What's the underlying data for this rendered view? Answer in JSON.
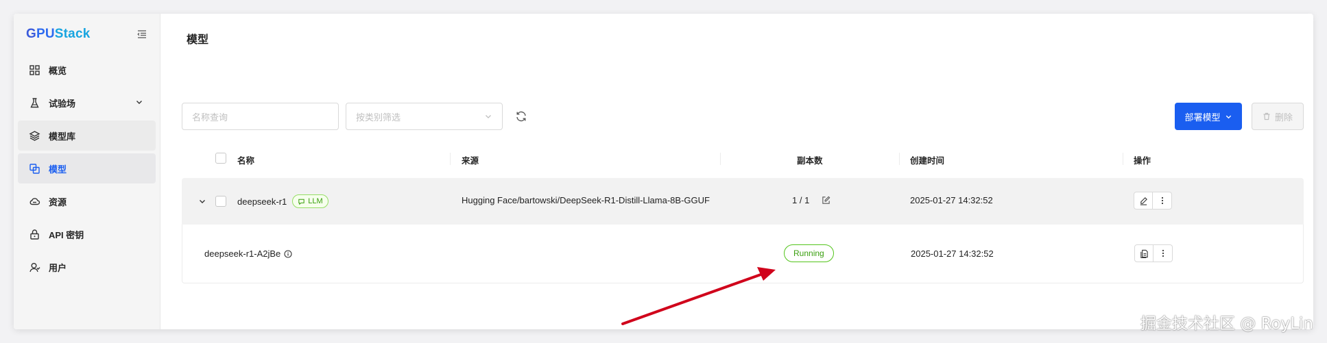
{
  "app": {
    "logo_text": [
      "G",
      "PU",
      "Stack"
    ]
  },
  "sidebar": {
    "items": [
      {
        "label": "概览",
        "icon": "dashboard-icon"
      },
      {
        "label": "试验场",
        "icon": "flask-icon"
      },
      {
        "label": "模型库",
        "icon": "layers-icon"
      },
      {
        "label": "模型",
        "icon": "models-icon"
      },
      {
        "label": "资源",
        "icon": "cloud-icon"
      },
      {
        "label": "API 密钥",
        "icon": "lock-icon"
      },
      {
        "label": "用户",
        "icon": "user-icon"
      }
    ]
  },
  "page": {
    "title": "模型"
  },
  "toolbar": {
    "search_placeholder": "名称查询",
    "filter_placeholder": "按类别筛选",
    "deploy_label": "部署模型",
    "delete_label": "删除"
  },
  "table": {
    "columns": [
      "名称",
      "来源",
      "副本数",
      "创建时间",
      "操作"
    ],
    "model": {
      "name": "deepseek-r1",
      "badge": "LLM",
      "source": "Hugging Face/bartowski/DeepSeek-R1-Distill-Llama-8B-GGUF",
      "replicas": "1 / 1",
      "created": "2025-01-27 14:32:52"
    },
    "instance": {
      "name": "deepseek-r1-A2jBe",
      "status": "Running",
      "created": "2025-01-27 14:32:52"
    }
  },
  "colors": {
    "accent": "#1a5ef0",
    "status_running": "#389e0d",
    "annotation_arrow": "#d0021b"
  },
  "watermark": "掘金技术社区 @ RoyLin"
}
